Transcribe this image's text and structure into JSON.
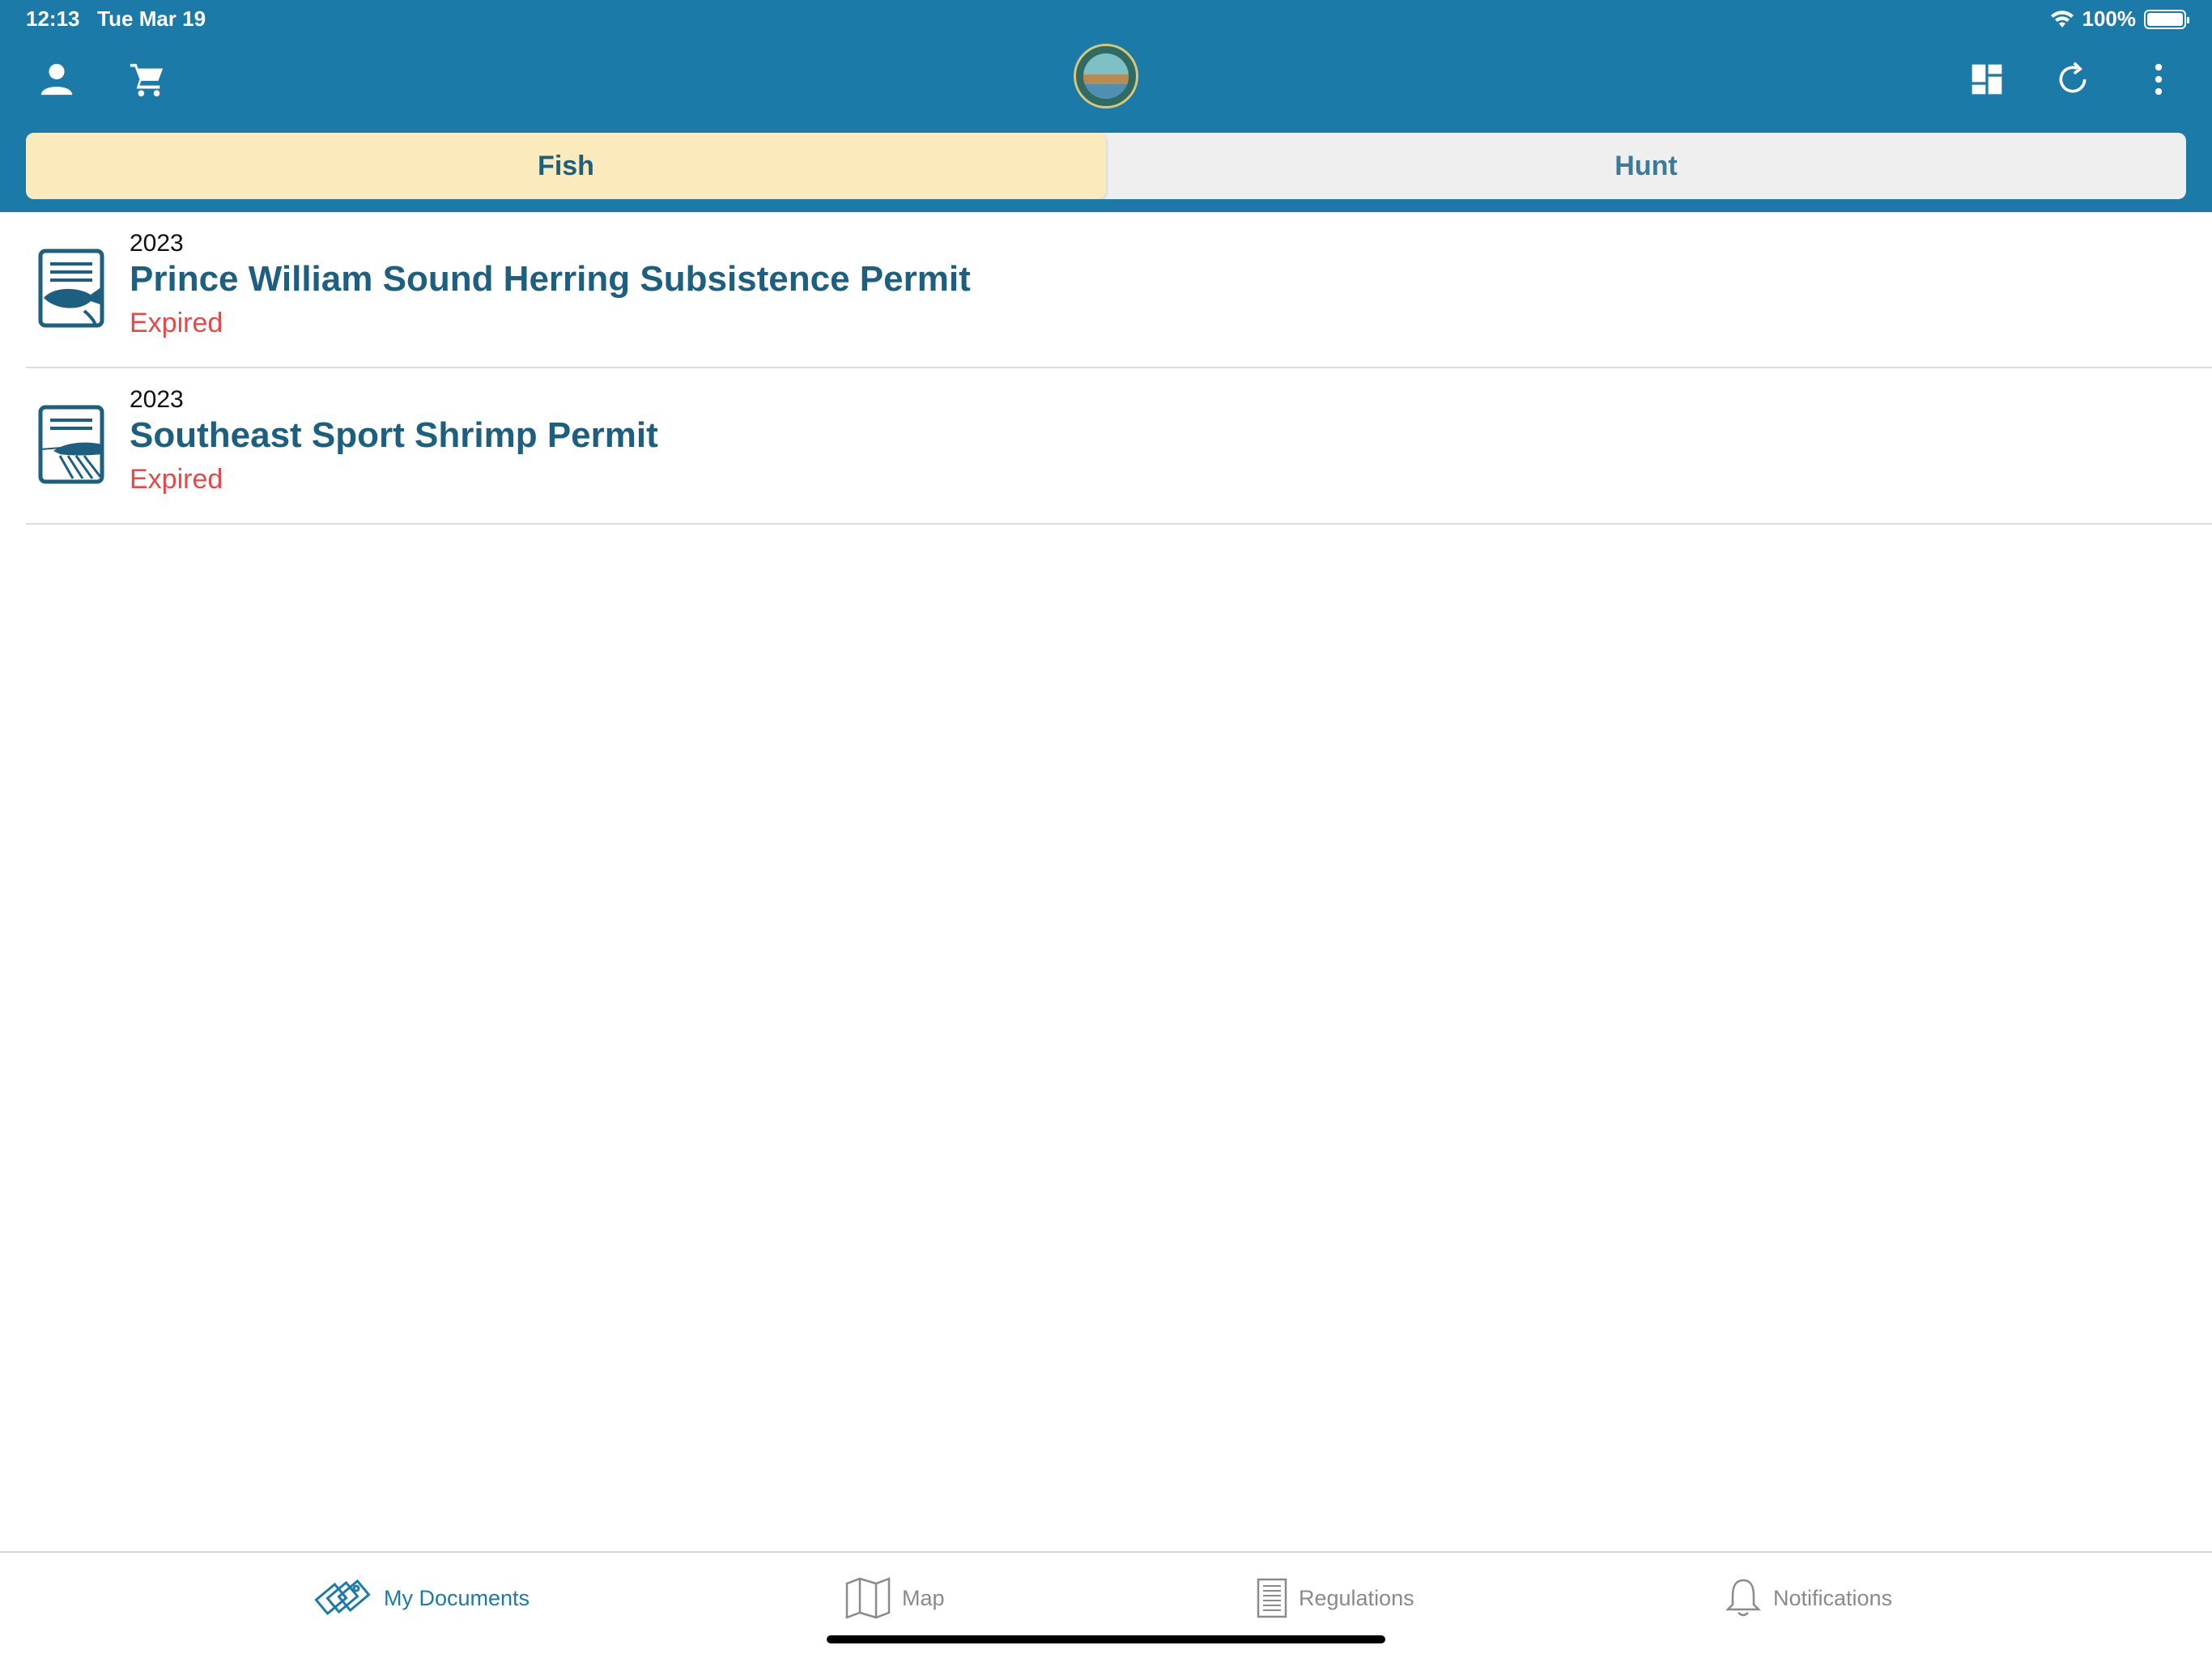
{
  "status_bar": {
    "time": "12:13",
    "date": "Tue Mar 19",
    "battery": "100%",
    "wifi_icon": "wifi-icon"
  },
  "header": {
    "left_icons": [
      "profile-icon",
      "cart-icon"
    ],
    "logo": "alaska-seal-logo",
    "right_icons": [
      "dashboard-icon",
      "refresh-icon",
      "more-vertical-icon"
    ],
    "tabs": [
      {
        "label": "Fish",
        "active": true
      },
      {
        "label": "Hunt",
        "active": false
      }
    ]
  },
  "documents": [
    {
      "year": "2023",
      "title": "Prince William Sound Herring Subsistence Permit",
      "status": "Expired",
      "icon": "fish-permit-icon"
    },
    {
      "year": "2023",
      "title": "Southeast Sport Shrimp Permit",
      "status": "Expired",
      "icon": "shrimp-permit-icon"
    }
  ],
  "tabbar": {
    "items": [
      {
        "label": "My Documents",
        "icon": "documents-icon",
        "active": true
      },
      {
        "label": "Map",
        "icon": "map-icon",
        "active": false
      },
      {
        "label": "Regulations",
        "icon": "regulations-icon",
        "active": false
      },
      {
        "label": "Notifications",
        "icon": "bell-icon",
        "active": false
      }
    ]
  },
  "colors": {
    "primary": "#1c7aa8",
    "active_tab": "#fbeabc",
    "expired": "#e84848",
    "title": "#1c5f80"
  }
}
